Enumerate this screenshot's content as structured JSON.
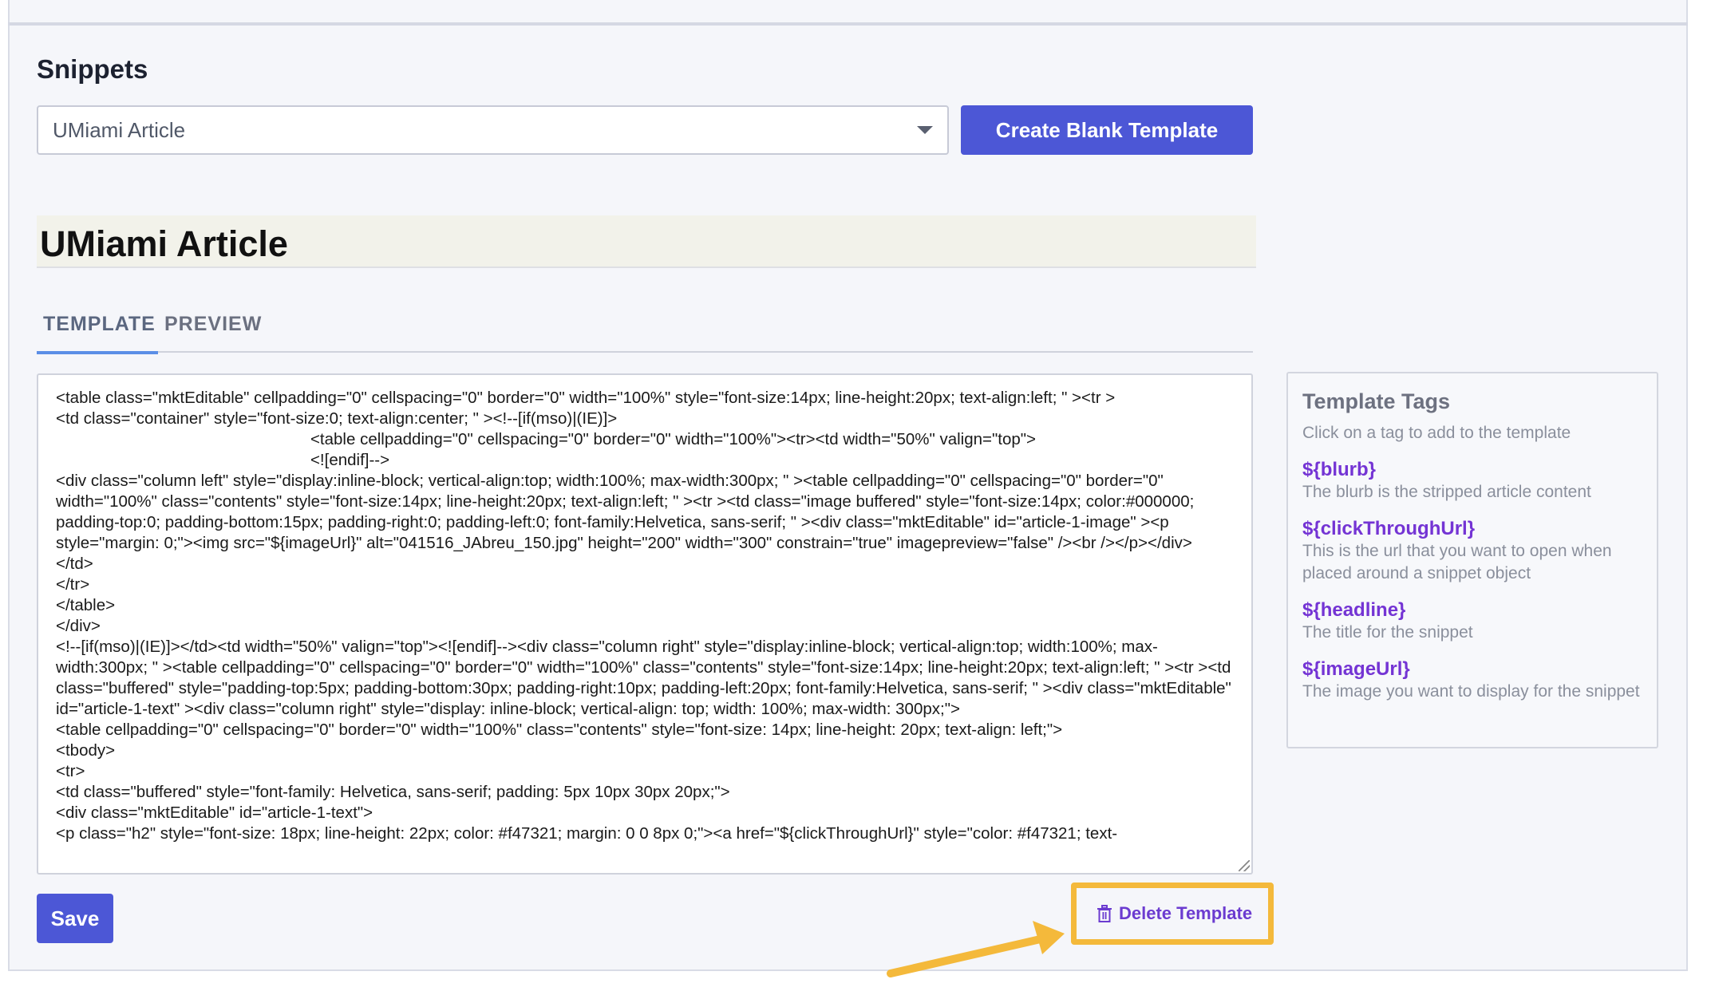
{
  "snippets": {
    "heading": "Snippets",
    "selected": "UMiami Article",
    "create_button": "Create Blank Template"
  },
  "template": {
    "title": "UMiami Article",
    "tabs": [
      {
        "label": "TEMPLATE",
        "active": true
      },
      {
        "label": "PREVIEW",
        "active": false
      }
    ],
    "code": "<table class=\"mktEditable\" cellpadding=\"0\" cellspacing=\"0\" border=\"0\" width=\"100%\" style=\"font-size:14px; line-height:20px; text-align:left; \" ><tr >\n<td class=\"container\" style=\"font-size:0; text-align:center; \" ><!--[if(mso)|(IE)]>\n                                                        <table cellpadding=\"0\" cellspacing=\"0\" border=\"0\" width=\"100%\"><tr><td width=\"50%\" valign=\"top\">\n                                                        <![endif]-->\n<div class=\"column left\" style=\"display:inline-block; vertical-align:top; width:100%; max-width:300px; \" ><table cellpadding=\"0\" cellspacing=\"0\" border=\"0\" width=\"100%\" class=\"contents\" style=\"font-size:14px; line-height:20px; text-align:left; \" ><tr ><td class=\"image buffered\" style=\"font-size:14px; color:#000000; padding-top:0; padding-bottom:15px; padding-right:0; padding-left:0; font-family:Helvetica, sans-serif; \" ><div class=\"mktEditable\" id=\"article-1-image\" ><p style=\"margin: 0;\"><img src=\"${imageUrl}\" alt=\"041516_JAbreu_150.jpg\" height=\"200\" width=\"300\" constrain=\"true\" imagepreview=\"false\" /><br /></p></div>\n</td>\n</tr>\n</table>\n</div>\n<!--[if(mso)|(IE)]></td><td width=\"50%\" valign=\"top\"><![endif]--><div class=\"column right\" style=\"display:inline-block; vertical-align:top; width:100%; max-width:300px; \" ><table cellpadding=\"0\" cellspacing=\"0\" border=\"0\" width=\"100%\" class=\"contents\" style=\"font-size:14px; line-height:20px; text-align:left; \" ><tr ><td class=\"buffered\" style=\"padding-top:5px; padding-bottom:30px; padding-right:10px; padding-left:20px; font-family:Helvetica, sans-serif; \" ><div class=\"mktEditable\" id=\"article-1-text\" ><div class=\"column right\" style=\"display: inline-block; vertical-align: top; width: 100%; max-width: 300px;\">\n<table cellpadding=\"0\" cellspacing=\"0\" border=\"0\" width=\"100%\" class=\"contents\" style=\"font-size: 14px; line-height: 20px; text-align: left;\">\n<tbody>\n<tr>\n<td class=\"buffered\" style=\"font-family: Helvetica, sans-serif; padding: 5px 10px 30px 20px;\">\n<div class=\"mktEditable\" id=\"article-1-text\">\n<p class=\"h2\" style=\"font-size: 18px; line-height: 22px; color: #f47321; margin: 0 0 8px 0;\"><a href=\"${clickThroughUrl}\" style=\"color: #f47321; text-"
  },
  "template_tags": {
    "title": "Template Tags",
    "subtitle": "Click on a tag to add to the template",
    "tags": [
      {
        "name": "${blurb}",
        "description": "The blurb is the stripped article content"
      },
      {
        "name": "${clickThroughUrl}",
        "description": "This is the url that you want to open when placed around a snippet object"
      },
      {
        "name": "${headline}",
        "description": "The title for the snippet"
      },
      {
        "name": "${imageUrl}",
        "description": "The image you want to display for the snippet"
      }
    ]
  },
  "actions": {
    "save": "Save",
    "delete": "Delete Template"
  },
  "icons": {
    "delete": "trash-icon",
    "select": "chevron-down-icon"
  },
  "colors": {
    "primary_button": "#4c57d6",
    "tag_color": "#7434d4",
    "highlight": "#f4b93b"
  }
}
